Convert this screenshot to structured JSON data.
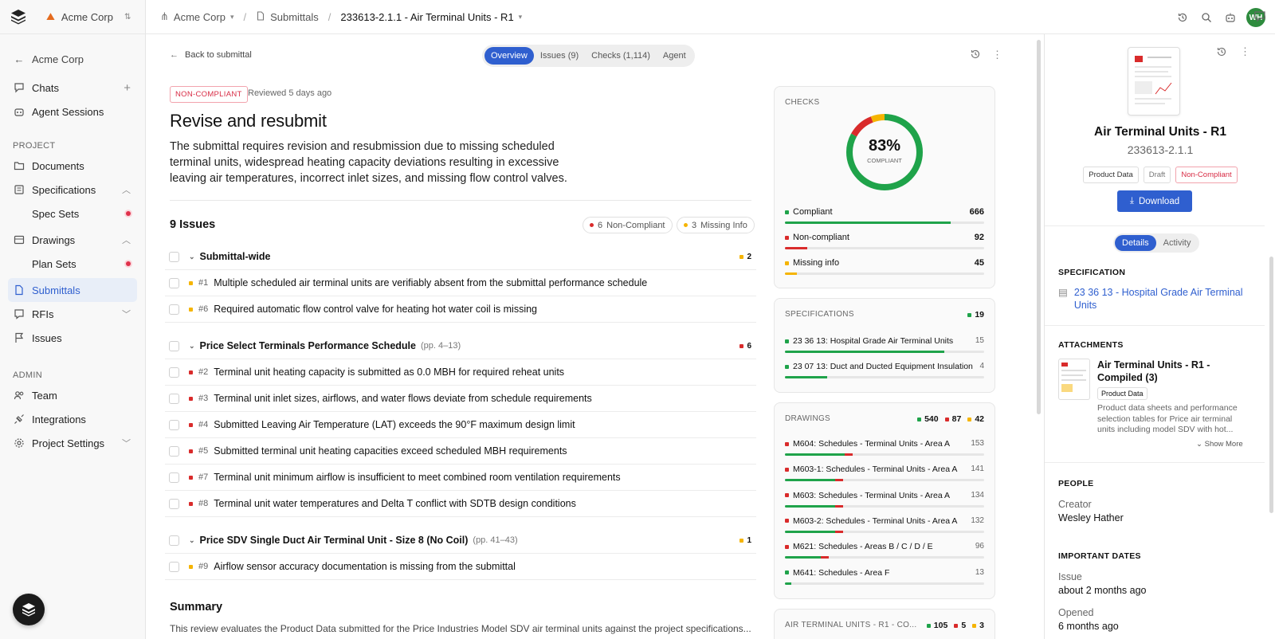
{
  "sidebar": {
    "org": "Acme Corp",
    "back_label": "Acme Corp",
    "items_top": [
      {
        "label": "Chats",
        "icon": "chat-icon",
        "right": "+"
      },
      {
        "label": "Agent Sessions",
        "icon": "robot-icon"
      }
    ],
    "project_label": "PROJECT",
    "project_items": [
      {
        "label": "Documents"
      },
      {
        "label": "Specifications"
      },
      {
        "label": "Spec Sets"
      },
      {
        "label": "Drawings"
      },
      {
        "label": "Plan Sets"
      },
      {
        "label": "Submittals"
      },
      {
        "label": "RFIs"
      },
      {
        "label": "Issues"
      }
    ],
    "admin_label": "ADMIN",
    "admin_items": [
      {
        "label": "Team"
      },
      {
        "label": "Integrations"
      },
      {
        "label": "Project Settings"
      }
    ]
  },
  "topbar": {
    "crumb1": "Acme Corp",
    "crumb2": "Submittals",
    "crumb3": "233613-2.1.1 - Air Terminal Units - R1",
    "avatar": "WH"
  },
  "main": {
    "back": "Back to submittal",
    "tabs": [
      "Overview",
      "Issues (9)",
      "Checks (1,114)",
      "Agent"
    ],
    "status_badge": "NON-COMPLIANT",
    "reviewed": "Reviewed 5 days ago",
    "title": "Revise and resubmit",
    "description": "The submittal requires revision and resubmission due to missing scheduled terminal units, widespread heating capacity deviations resulting in excessive leaving air temperatures, incorrect inlet sizes, and missing flow control valves.",
    "issues_title": "9 Issues",
    "pill_noncompliant": {
      "count": "6",
      "label": "Non-Compliant"
    },
    "pill_missing": {
      "count": "3",
      "label": "Missing Info"
    },
    "groups": [
      {
        "title": "Submittal-wide",
        "pages": "",
        "count": "2",
        "color": "#f5b400",
        "issues": [
          {
            "num": "#1",
            "text": "Multiple scheduled air terminal units are verifiably absent from the submittal performance schedule",
            "color": "#f5b400"
          },
          {
            "num": "#6",
            "text": "Required automatic flow control valve for heating hot water coil is missing",
            "color": "#f5b400"
          }
        ]
      },
      {
        "title": "Price Select Terminals Performance Schedule",
        "pages": "(pp. 4–13)",
        "count": "6",
        "color": "#d92b2b",
        "issues": [
          {
            "num": "#2",
            "text": "Terminal unit heating capacity is submitted as 0.0 MBH for required reheat units",
            "color": "#d92b2b"
          },
          {
            "num": "#3",
            "text": "Terminal unit inlet sizes, airflows, and water flows deviate from schedule requirements",
            "color": "#d92b2b"
          },
          {
            "num": "#4",
            "text": "Submitted Leaving Air Temperature (LAT) exceeds the 90°F maximum design limit",
            "color": "#d92b2b"
          },
          {
            "num": "#5",
            "text": "Submitted terminal unit heating capacities exceed scheduled MBH requirements",
            "color": "#d92b2b"
          },
          {
            "num": "#7",
            "text": "Terminal unit minimum airflow is insufficient to meet combined room ventilation requirements",
            "color": "#d92b2b"
          },
          {
            "num": "#8",
            "text": "Terminal unit water temperatures and Delta T conflict with SDTB design conditions",
            "color": "#d92b2b"
          }
        ]
      },
      {
        "title": "Price SDV Single Duct Air Terminal Unit - Size 8 (No Coil)",
        "pages": "(pp. 41–43)",
        "count": "1",
        "color": "#f5b400",
        "issues": [
          {
            "num": "#9",
            "text": "Airflow sensor accuracy documentation is missing from the submittal",
            "color": "#f5b400"
          }
        ]
      }
    ],
    "summary_title": "Summary",
    "summary_text": "This review evaluates the Product Data submitted for the Price Industries Model SDV air terminal units against the project specifications..."
  },
  "checks": {
    "title": "CHECKS",
    "percent": "83%",
    "percent_value": 0.83,
    "percent_label": "COMPLIANT",
    "stats": [
      {
        "label": "Compliant",
        "value": "666",
        "color": "#1fa34a",
        "fraction": 0.83
      },
      {
        "label": "Non-compliant",
        "value": "92",
        "color": "#d92b2b",
        "fraction": 0.11
      },
      {
        "label": "Missing info",
        "value": "45",
        "color": "#f5b400",
        "fraction": 0.06
      }
    ]
  },
  "specifications": {
    "title": "SPECIFICATIONS",
    "count": "19",
    "items": [
      {
        "label": "23 36 13: Hospital Grade Air Terminal Units",
        "value": "15",
        "fraction": 0.8
      },
      {
        "label": "23 07 13: Duct and Ducted Equipment Insulation",
        "value": "4",
        "fraction": 0.21
      }
    ]
  },
  "drawings": {
    "title": "DRAWINGS",
    "green": "540",
    "red": "87",
    "yellow": "42",
    "items": [
      {
        "label": "M604: Schedules - Terminal Units - Area A",
        "value": "153",
        "fraction": 0.3
      },
      {
        "label": "M603-1: Schedules - Terminal Units - Area A",
        "value": "141",
        "fraction": 0.25
      },
      {
        "label": "M603: Schedules - Terminal Units - Area A",
        "value": "134",
        "fraction": 0.25
      },
      {
        "label": "M603-2: Schedules - Terminal Units - Area A",
        "value": "132",
        "fraction": 0.25
      },
      {
        "label": "M621: Schedules - Areas B / C / D / E",
        "value": "96",
        "fraction": 0.18
      },
      {
        "label": "M641: Schedules - Area F",
        "value": "13",
        "fraction": 0.03
      }
    ]
  },
  "next_card": {
    "title": "AIR TERMINAL UNITS - R1 - CO...",
    "green": "105",
    "red": "5",
    "yellow": "3"
  },
  "details": {
    "title": "Air Terminal Units - R1",
    "number": "233613-2.1.1",
    "tags": [
      "Product Data",
      "Draft",
      "Non-Compliant"
    ],
    "download": "Download",
    "tabs": [
      "Details",
      "Activity"
    ],
    "spec_heading": "SPECIFICATION",
    "spec_link": "23 36 13 - Hospital Grade Air Terminal Units",
    "attachments_heading": "ATTACHMENTS",
    "attachment_title": "Air Terminal Units - R1 - Compiled (3)",
    "attachment_tag": "Product Data",
    "attachment_desc": "Product data sheets and performance selection tables for Price air terminal units including model SDV with hot...",
    "show_more": "Show More",
    "people_heading": "PEOPLE",
    "creator_label": "Creator",
    "creator": "Wesley Hather",
    "dates_heading": "IMPORTANT DATES",
    "issue_label": "Issue",
    "issue_value": "about 2 months ago",
    "opened_label": "Opened",
    "opened_value": "6 months ago"
  }
}
